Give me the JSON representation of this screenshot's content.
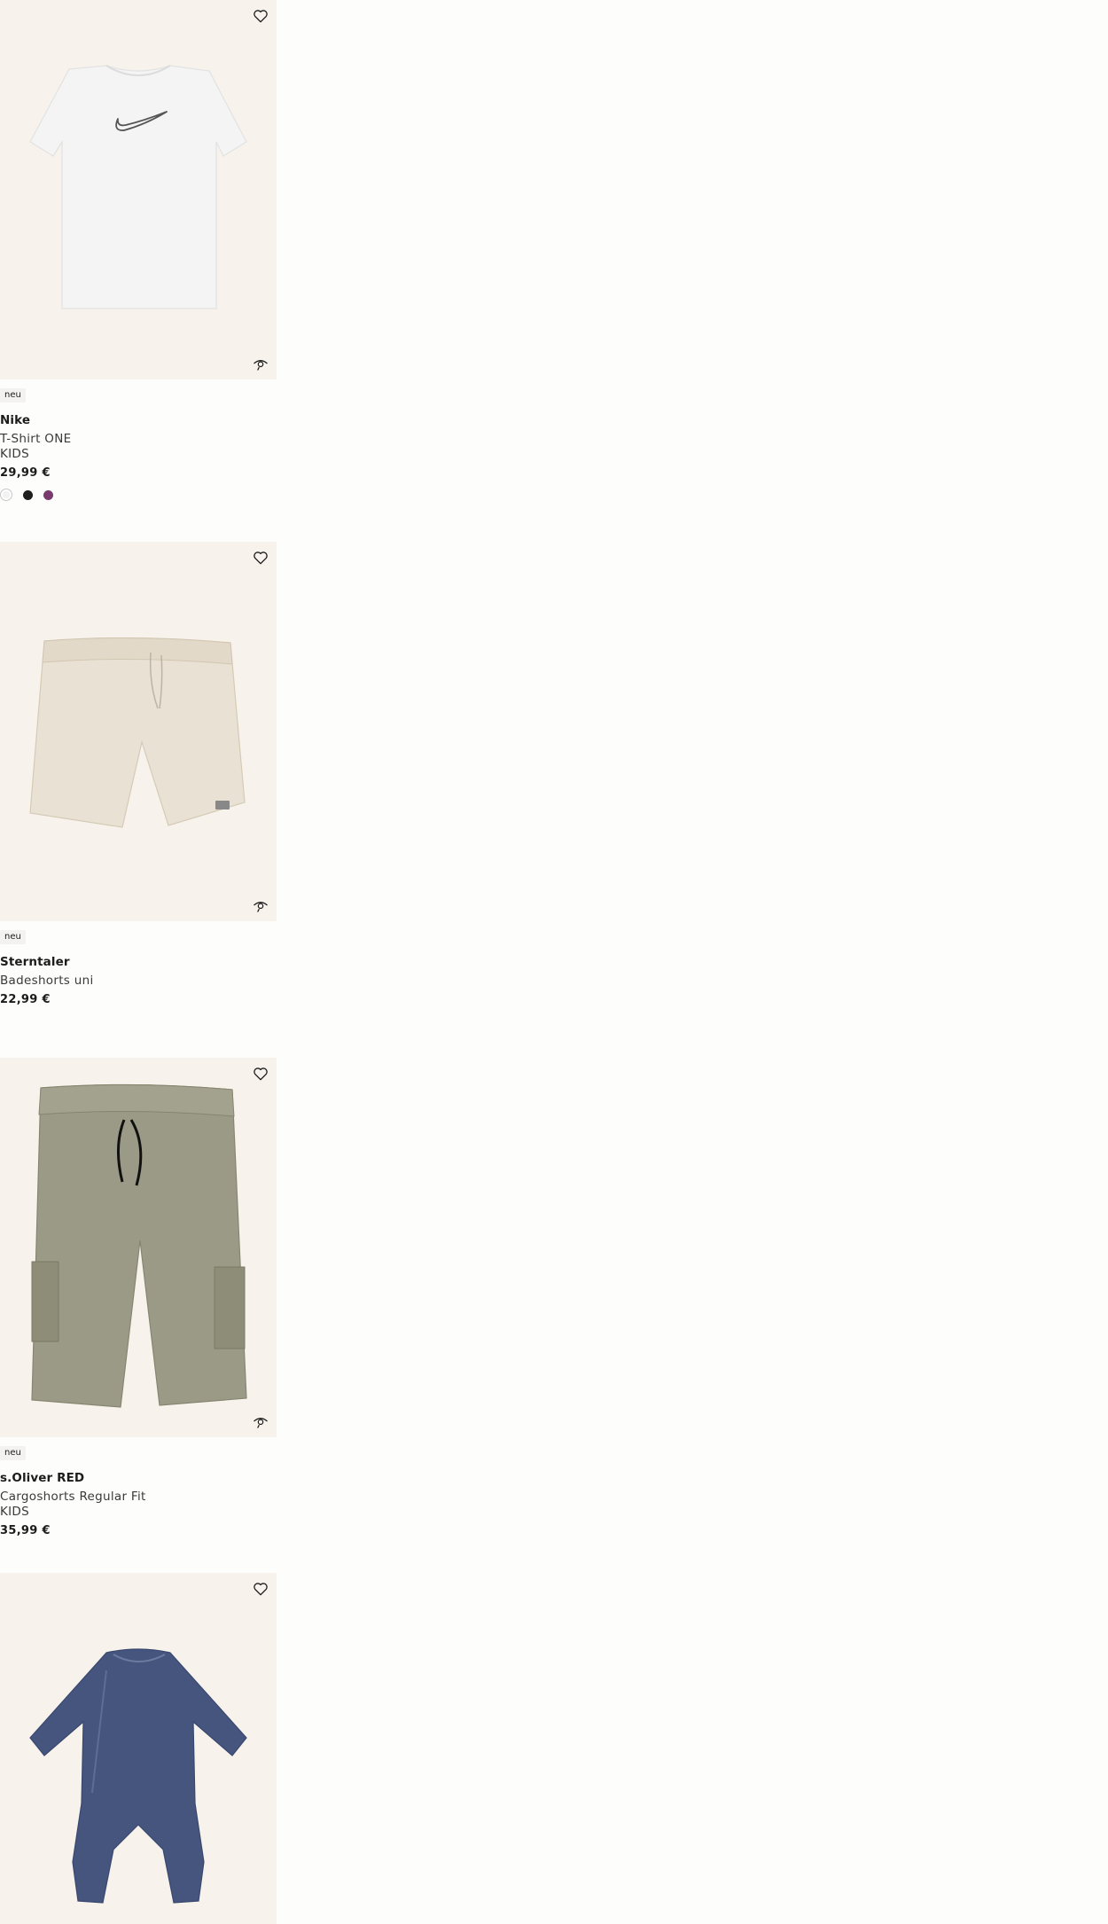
{
  "products": [
    {
      "badge": "neu",
      "brand": "Nike",
      "name": "T-Shirt ONE",
      "name2": "KIDS",
      "price": "29,99 €",
      "swatches": [
        "#f2f2f2",
        "#1e1e1e",
        "#7a3a6e"
      ],
      "image": "white-tshirt-with-swoosh"
    },
    {
      "badge": "neu",
      "brand": "Sterntaler",
      "name": "Badeshorts uni",
      "price": "22,99 €",
      "image": "beige-swim-shorts"
    },
    {
      "badge": "neu",
      "brand": "s.Oliver RED",
      "name": "Cargoshorts Regular Fit",
      "name2": "KIDS",
      "price": "35,99 €",
      "image": "olive-cargo-shorts"
    },
    {
      "image": "navy-baby-romper"
    }
  ],
  "icons": {
    "wishlist": "heart-outline-icon",
    "similar": "eye-similar-icon"
  }
}
